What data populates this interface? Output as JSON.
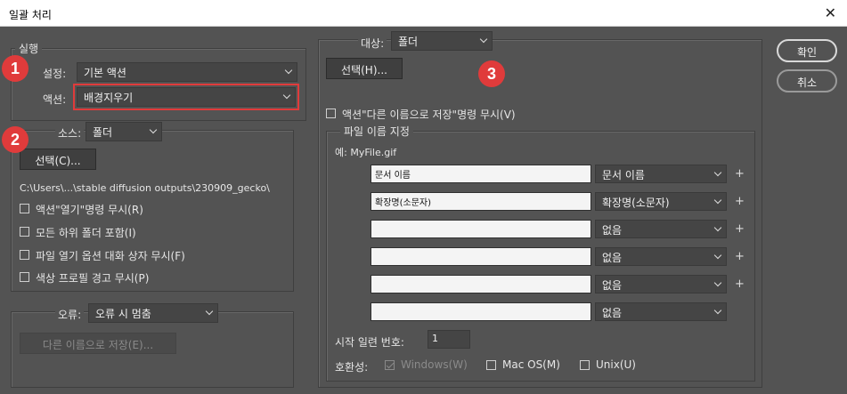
{
  "window": {
    "title": "일괄 처리",
    "close_glyph": "✕"
  },
  "play": {
    "legend": "실행",
    "set_label": "설정:",
    "set_value": "기본 액션",
    "action_label": "액션:",
    "action_value": "배경지우기"
  },
  "source": {
    "label": "소스:",
    "value": "폴더",
    "choose_button": "선택(C)...",
    "path": "C:\\Users\\...\\stable diffusion outputs\\230909_gecko\\",
    "options": [
      "액션\"열기\"명령 무시(R)",
      "모든 하위 폴더 포함(I)",
      "파일 열기 옵션 대화 상자 무시(F)",
      "색상 프로필 경고 무시(P)"
    ]
  },
  "errors": {
    "label": "오류:",
    "value": "오류 시 멈춤",
    "save_as_button": "다른 이름으로 저장(E)..."
  },
  "destination": {
    "label": "대상:",
    "value": "폴더",
    "choose_button": "선택(H)...",
    "override_save": "액션\"다른 이름으로 저장\"명령 무시(V)"
  },
  "file_naming": {
    "legend": "파일 이름 지정",
    "example": "예: MyFile.gif",
    "rows": [
      {
        "input": "문서 이름",
        "select": "문서 이름",
        "plus": "+"
      },
      {
        "input": "확장명(소문자)",
        "select": "확장명(소문자)",
        "plus": "+"
      },
      {
        "input": "",
        "select": "없음",
        "plus": "+"
      },
      {
        "input": "",
        "select": "없음",
        "plus": "+"
      },
      {
        "input": "",
        "select": "없음",
        "plus": "+"
      },
      {
        "input": "",
        "select": "없음",
        "plus": ""
      }
    ],
    "serial_label": "시작 일련 번호:",
    "serial_value": "1",
    "compat_label": "호환성:",
    "compat": [
      {
        "label": "Windows(W)",
        "checked": true,
        "disabled": true
      },
      {
        "label": "Mac OS(M)",
        "checked": false,
        "disabled": false
      },
      {
        "label": "Unix(U)",
        "checked": false,
        "disabled": false
      }
    ]
  },
  "buttons": {
    "ok": "확인",
    "cancel": "취소"
  },
  "markers": [
    "1",
    "2",
    "3"
  ],
  "colors": {
    "accent": "#e03b3b",
    "background": "#535353"
  }
}
